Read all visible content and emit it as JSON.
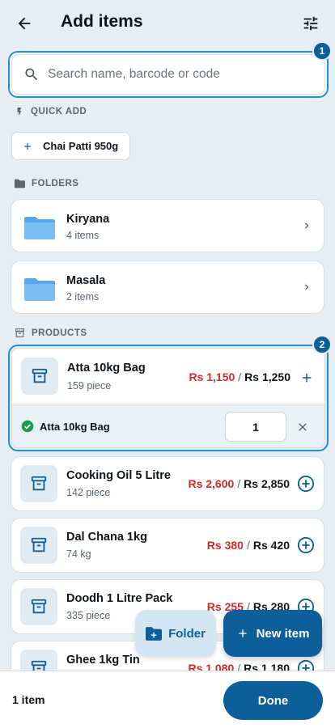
{
  "header": {
    "title": "Add items"
  },
  "search": {
    "placeholder": "Search name, barcode or code"
  },
  "badges": [
    "1",
    "2"
  ],
  "quick_add": {
    "label": "QUICK ADD",
    "chip": "Chai Patti 950g"
  },
  "folders": {
    "label": "FOLDERS",
    "items": [
      {
        "name": "Kiryana",
        "count": "4 items"
      },
      {
        "name": "Masala",
        "count": "2 items"
      }
    ]
  },
  "products": {
    "label": "PRODUCTS",
    "items": [
      {
        "name": "Atta 10kg Bag",
        "stock": "159 piece",
        "sale_price": "Rs 1,150",
        "mrp": "Rs 1,250"
      },
      {
        "name": "Cooking Oil 5 Litre",
        "stock": "142 piece",
        "sale_price": "Rs 2,600",
        "mrp": "Rs 2,850"
      },
      {
        "name": "Dal Chana 1kg",
        "stock": "74 kg",
        "sale_price": "Rs 380",
        "mrp": "Rs 420"
      },
      {
        "name": "Doodh 1 Litre Pack",
        "stock": "335 piece",
        "sale_price": "Rs 255",
        "mrp": "Rs 280"
      },
      {
        "name": "Ghee 1kg Tin",
        "stock": "",
        "sale_price": "Rs 1,080",
        "mrp": "Rs 1,180"
      }
    ]
  },
  "selected_line": {
    "name": "Atta 10kg Bag",
    "quantity": "1"
  },
  "fab": {
    "folder_label": "Folder",
    "new_item_label": "New item"
  },
  "footer": {
    "count": "1 item",
    "done_label": "Done"
  },
  "colors": {
    "accent": "#0d5f9a",
    "highlight": "#1f8fd8",
    "sale_red": "#d32a2a",
    "background": "#e6eef3"
  }
}
